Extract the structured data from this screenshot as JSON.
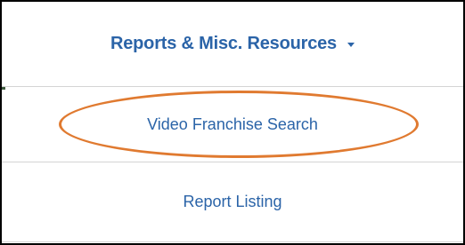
{
  "menu": {
    "title": "Reports & Misc. Resources",
    "caret_icon": "caret-down-icon",
    "items": [
      {
        "label": "Video Franchise Search"
      },
      {
        "label": "Report Listing"
      }
    ]
  },
  "annotation": {
    "shape": "ellipse",
    "color": "#e07a30",
    "target": "Video Franchise Search"
  },
  "colors": {
    "link": "#2b64a8",
    "divider": "#d4d4d4",
    "border": "#000000"
  }
}
